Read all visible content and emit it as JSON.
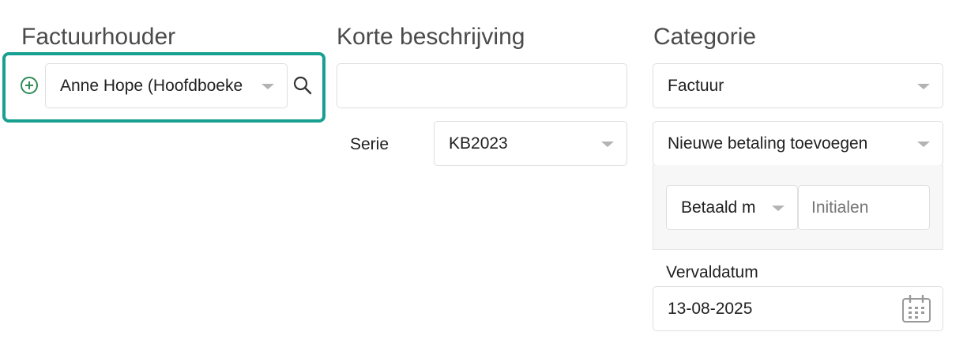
{
  "invoice_holder": {
    "heading": "Factuurhouder",
    "selected": "Anne Hope (Hoofdboeke",
    "icons": [
      "add-circle-icon",
      "chevron-down-icon",
      "search-icon"
    ],
    "highlight_color": "#17a091"
  },
  "short_description": {
    "heading": "Korte beschrijving",
    "value": "",
    "series_label": "Serie",
    "series_value": "KB2023"
  },
  "category": {
    "heading": "Categorie",
    "selected": "Factuur",
    "payment_action": "Nieuwe betaling toevoegen",
    "paid_method": "Betaald m",
    "initials_placeholder": "Initialen",
    "due_date_label": "Vervaldatum",
    "due_date_value": "13-08-2025",
    "icons": [
      "calendar-icon"
    ]
  }
}
